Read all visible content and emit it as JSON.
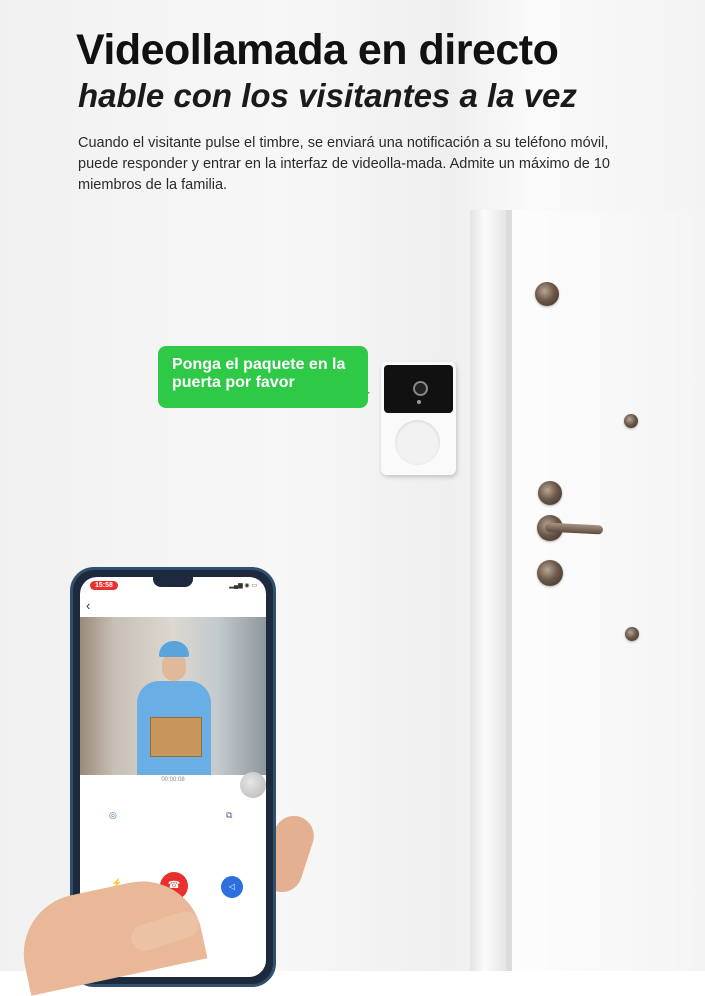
{
  "header": {
    "title": "Videollamada en directo",
    "subtitle": "hable con los visitantes a la vez",
    "description": "Cuando el visitante pulse el timbre, se enviará una notificación a su teléfono móvil, puede responder y entrar en la interfaz de videolla-mada. Admite un máximo de 10 miembros de la familia."
  },
  "speech_bubble": {
    "text": "Ponga el paquete en la puerta por favor",
    "color": "#2fc948"
  },
  "phone": {
    "status_time": "15:58",
    "call_timer": "00:00:08",
    "icons": [
      "back-chevron-icon",
      "camera-icon",
      "screenshot-icon",
      "mute-icon",
      "hang-up-icon",
      "speaker-icon"
    ],
    "hangup_color": "#e8302e",
    "speaker_color": "#2e6fe0"
  }
}
